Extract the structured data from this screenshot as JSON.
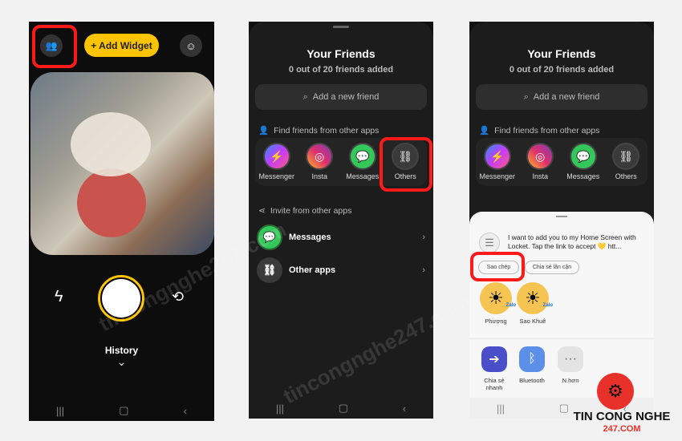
{
  "phone1": {
    "add_widget": "+ Add Widget",
    "history": "History",
    "icons": [
      "friends-icon",
      "profile-icon",
      "flash-icon",
      "shutter",
      "flip-camera-icon",
      "chevron-down-icon"
    ]
  },
  "friends": {
    "title": "Your Friends",
    "subtitle": "0 out of 20 friends added",
    "search_placeholder": "Add a new friend",
    "find_section": "Find friends from other apps",
    "apps": [
      {
        "label": "Messenger",
        "color": "#7b4dff"
      },
      {
        "label": "Insta",
        "color": "#e1306c"
      },
      {
        "label": "Messages",
        "color": "#34c759"
      },
      {
        "label": "Others",
        "color": "#3a3a3a"
      }
    ],
    "invite_section": "Invite from other apps",
    "invite_rows": [
      "Messages",
      "Other apps"
    ]
  },
  "share": {
    "message": "I want to add you to my Home Screen with Locket. Tap the link to accept 💛 htt...",
    "copy": "Sao chép",
    "nearby": "Chia sẻ lân cận",
    "contacts": [
      {
        "name": "Phượng",
        "badge": "Zalo"
      },
      {
        "name": "Sao Khuê",
        "badge": "Zalo"
      }
    ],
    "apps": [
      {
        "label": "Chia sẻ nhanh",
        "color": "#4b4fc7"
      },
      {
        "label": "Bluetooth",
        "color": "#5b8fe8"
      },
      {
        "label": "N.hơn",
        "color": "#e3e3e3"
      }
    ]
  },
  "nav": {
    "recent": "|||",
    "home": "▢",
    "back": "‹"
  },
  "watermark": "tincongnghe247.com",
  "logo": {
    "line1": "TIN CONG NGHE",
    "line2": "247.COM"
  }
}
